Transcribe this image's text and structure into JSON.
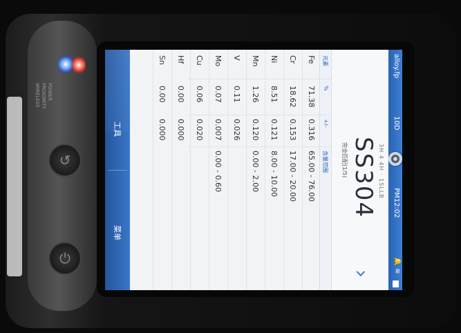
{
  "device": {
    "label_lines": "POWER\nPROXIMITY\nWIRELESS",
    "back_icon": "back-arrow-icon",
    "power_icon": "power-icon"
  },
  "status_bar": {
    "app": "alloy.fp",
    "vtab": "10D",
    "time": "PM12:02",
    "bell": "🔔",
    "wifi": "≋"
  },
  "result": {
    "subtitle": "3H 4 4H · 1SLLB",
    "alloy": "SS304",
    "match": "完全匹配(1/5)",
    "next": "›"
  },
  "table": {
    "headers": {
      "element": "元素",
      "percent": "%",
      "error": "+/-",
      "range": "含量范围"
    },
    "rows": [
      {
        "element": "Fe",
        "percent": "71.38",
        "error": "0.316",
        "range": "65.00 - 76.00"
      },
      {
        "element": "Cr",
        "percent": "18.62",
        "error": "0.153",
        "range": "17.00 - 20.00"
      },
      {
        "element": "Ni",
        "percent": "8.51",
        "error": "0.121",
        "range": "8.00 - 10.00"
      },
      {
        "element": "Mn",
        "percent": "1.26",
        "error": "0.120",
        "range": "0.00 - 2.00"
      },
      {
        "element": "V",
        "percent": "0.11",
        "error": "0.026",
        "range": ""
      },
      {
        "element": "Mo",
        "percent": "0.07",
        "error": "0.007",
        "range": "0.00 - 0.60"
      },
      {
        "element": "Cu",
        "percent": "0.06",
        "error": "0.020",
        "range": ""
      },
      {
        "element": "Hf",
        "percent": "0.00",
        "error": "0.000",
        "range": ""
      },
      {
        "element": "Sn",
        "percent": "0.00",
        "error": "0.000",
        "range": ""
      }
    ]
  },
  "bottom_bar": {
    "tools": "工具",
    "menu": "菜单"
  },
  "colors": {
    "accent": "#2b63b3",
    "screen_bg": "#f2f3f5"
  }
}
